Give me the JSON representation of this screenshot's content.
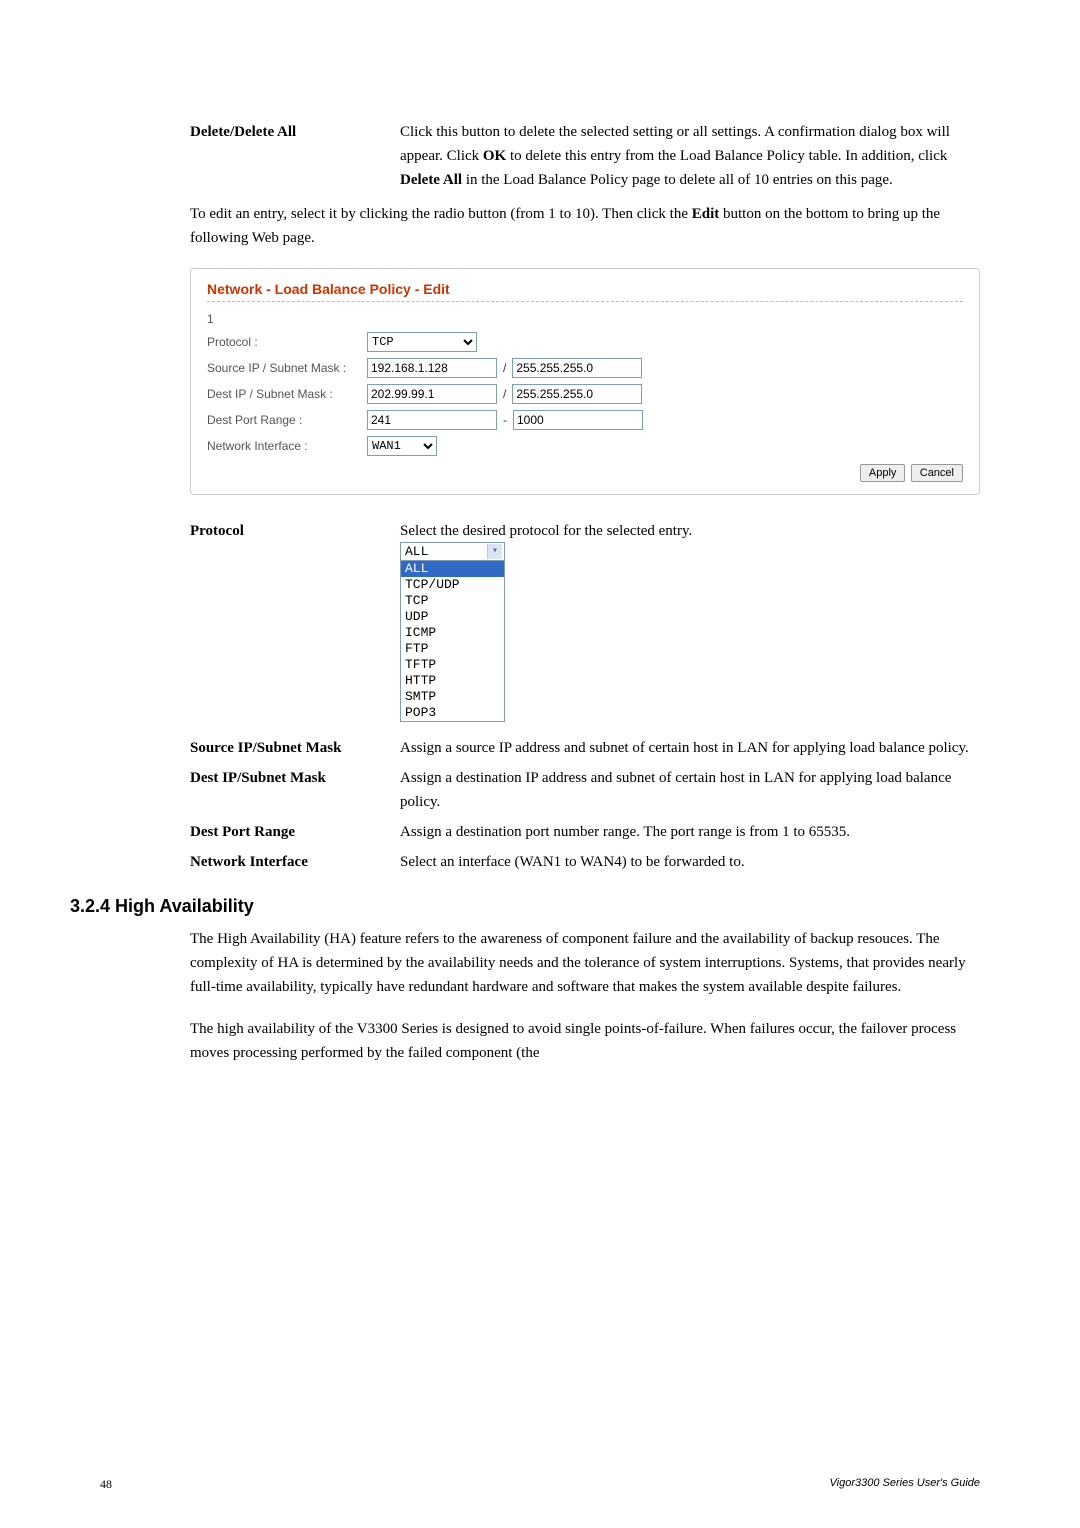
{
  "top": {
    "label": "Delete/Delete All",
    "desc_parts": {
      "p1": "Click this button to delete the selected setting or all settings. A confirmation dialog box will appear. Click ",
      "b1": "OK",
      "p2": " to delete this entry from the Load Balance Policy table. In addition, click ",
      "b2": "Delete All",
      "p3": " in the Load Balance Policy page to delete all of 10 entries on this page."
    }
  },
  "instr": {
    "p1": "To edit an entry, select it by clicking the radio button (from 1 to 10). Then click the ",
    "b1": "Edit",
    "p2": " button on the bottom to bring up the following Web page."
  },
  "panel": {
    "title": "Network - Load Balance Policy - Edit",
    "index": "1",
    "rows": {
      "protocol_label": "Protocol :",
      "protocol_value": "TCP",
      "src_label": "Source IP / Subnet Mask :",
      "src_ip": "192.168.1.128",
      "src_mask": "255.255.255.0",
      "dst_label": "Dest IP / Subnet Mask :",
      "dst_ip": "202.99.99.1",
      "dst_mask": "255.255.255.0",
      "port_label": "Dest Port Range :",
      "port_from": "241",
      "port_to": "1000",
      "iface_label": "Network Interface :",
      "iface_value": "WAN1"
    },
    "buttons": {
      "apply": "Apply",
      "cancel": "Cancel"
    }
  },
  "params": {
    "protocol": {
      "label": "Protocol",
      "desc": "Select the desired protocol for the selected entry.",
      "selected": "ALL",
      "options": [
        "ALL",
        "TCP/UDP",
        "TCP",
        "UDP",
        "ICMP",
        "FTP",
        "TFTP",
        "HTTP",
        "SMTP",
        "POP3"
      ]
    },
    "src": {
      "label": "Source IP/Subnet Mask",
      "desc": "Assign a source IP address and subnet of certain host in LAN for applying load balance policy."
    },
    "dst": {
      "label": "Dest IP/Subnet Mask",
      "desc": "Assign a destination IP address and subnet of certain host in LAN for applying load balance policy."
    },
    "port": {
      "label": "Dest Port Range",
      "desc": "Assign a destination port number range. The port range is from 1 to 65535."
    },
    "iface": {
      "label": "Network Interface",
      "desc": "Select an interface (WAN1 to WAN4) to be forwarded to."
    }
  },
  "section": {
    "heading": "3.2.4 High Availability",
    "p1": "The High Availability (HA) feature refers to the awareness of component failure and the availability of backup resouces. The complexity of HA is determined by the availability needs and the tolerance of system interruptions. Systems, that provides nearly full-time availability, typically have redundant hardware and software that makes the system available despite failures.",
    "p2": "The high availability of the V3300 Series is designed to avoid single points-of-failure. When failures occur, the failover process moves processing performed by the failed component (the"
  },
  "footer": {
    "page": "48",
    "guide": "Vigor3300 Series User's Guide"
  }
}
